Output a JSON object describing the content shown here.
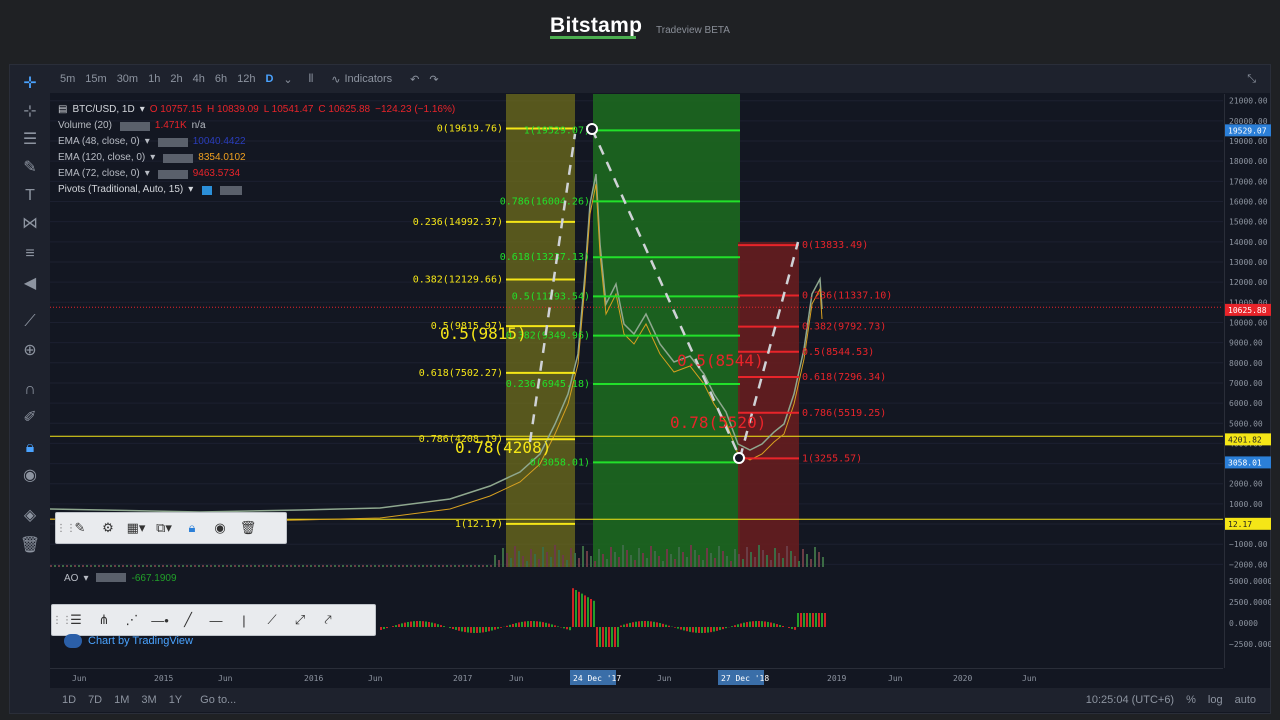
{
  "header": {
    "logo": "Bitstamp",
    "subtitle": "Tradeview BETA"
  },
  "timeframes": [
    "5m",
    "15m",
    "30m",
    "1h",
    "2h",
    "4h",
    "6h",
    "12h",
    "D"
  ],
  "active_timeframe": "D",
  "indicators_label": "Indicators",
  "legend": {
    "symbol": "BTC/USD, 1D",
    "o": "O 10757.15",
    "h": "H 10839.09",
    "l": "L 10541.47",
    "c": "C 10625.88",
    "change": "−124.23 (−1.16%)",
    "volume": "Volume (20)",
    "volume_val": "1.471K",
    "volume_na": "n/a",
    "ema48": "EMA (48, close, 0)",
    "ema48_val": "10040.4422",
    "ema120": "EMA (120, close, 0)",
    "ema120_val": "8354.0102",
    "ema72": "EMA (72, close, 0)",
    "ema72_val": "9463.5734",
    "pivots": "Pivots (Traditional, Auto, 15)"
  },
  "price_axis": [
    "21000.00",
    "20000.00",
    "19000.00",
    "18000.00",
    "17000.00",
    "16000.00",
    "15000.00",
    "14000.00",
    "13000.00",
    "12000.00",
    "11000.00",
    "10000.00",
    "9000.00",
    "8000.00",
    "7000.00",
    "6000.00",
    "5000.00",
    "4000.00",
    "3000.00",
    "2000.00",
    "1000.00",
    "0.00",
    "−1000.00",
    "−2000.00"
  ],
  "price_badges": {
    "top": "19529.07",
    "last": "10625.88",
    "yellow": "4201.82",
    "low": "3058.01",
    "base": "12.17"
  },
  "ao_axis": [
    "5000.0000",
    "2500.0000",
    "0.0000",
    "−2500.0000"
  ],
  "ao_label": "AO",
  "ao_value": "-667.1909",
  "time_axis": [
    "Jun",
    "2015",
    "Jun",
    "2016",
    "Jun",
    "2017",
    "Jun",
    "Jun",
    "2019",
    "Jun",
    "2020",
    "Jun"
  ],
  "time_badges": [
    "24 Dec '17",
    "27 Dec '18"
  ],
  "fib_yellow": [
    {
      "label": "0(19619.76)",
      "value": 19619.76
    },
    {
      "label": "0.236(14992.37)",
      "value": 14992.37
    },
    {
      "label": "0.382(12129.66)",
      "value": 12129.66
    },
    {
      "label": "0.5(9815.97)",
      "value": 9815.97
    },
    {
      "label": "0.618(7502.27)",
      "value": 7502.27
    },
    {
      "label": "0.786(4208.19)",
      "value": 4208.19
    },
    {
      "label": "1(12.17)",
      "value": 12.17
    }
  ],
  "fib_green": [
    {
      "label": "1(19529.07)",
      "value": 19529.07
    },
    {
      "label": "0.786(16004.26)",
      "value": 16004.26
    },
    {
      "label": "0.618(13237.13)",
      "value": 13237.13
    },
    {
      "label": "0.5(11293.54)",
      "value": 11293.54
    },
    {
      "label": "0.382(9349.96)",
      "value": 9349.96
    },
    {
      "label": "0.236(6945.18)",
      "value": 6945.18
    },
    {
      "label": "0(3058.01)",
      "value": 3058.01
    }
  ],
  "fib_red": [
    {
      "label": "0(13833.49)",
      "value": 13833.49
    },
    {
      "label": "0.236(11337.10)",
      "value": 11337.1
    },
    {
      "label": "0.382(9792.73)",
      "value": 9792.73
    },
    {
      "label": "0.5(8544.53)",
      "value": 8544.53
    },
    {
      "label": "0.618(7296.34)",
      "value": 7296.34
    },
    {
      "label": "0.786(5519.25)",
      "value": 5519.25
    },
    {
      "label": "1(3255.57)",
      "value": 3255.57
    }
  ],
  "annotations": {
    "yellow_05": "0.5(9815)",
    "yellow_078": "0.78(4208)",
    "red_05": "0.5(8544)",
    "red_078": "0.78(5520)"
  },
  "bottom": {
    "ranges": [
      "1D",
      "7D",
      "1M",
      "3M",
      "1Y"
    ],
    "goto": "Go to...",
    "time": "10:25:04 (UTC+6)",
    "pct": "%",
    "log": "log",
    "auto": "auto"
  },
  "tradingview": "Chart by TradingView",
  "colors": {
    "yellow": "#f5e617",
    "green": "#22e02a",
    "red": "#e8242a"
  }
}
